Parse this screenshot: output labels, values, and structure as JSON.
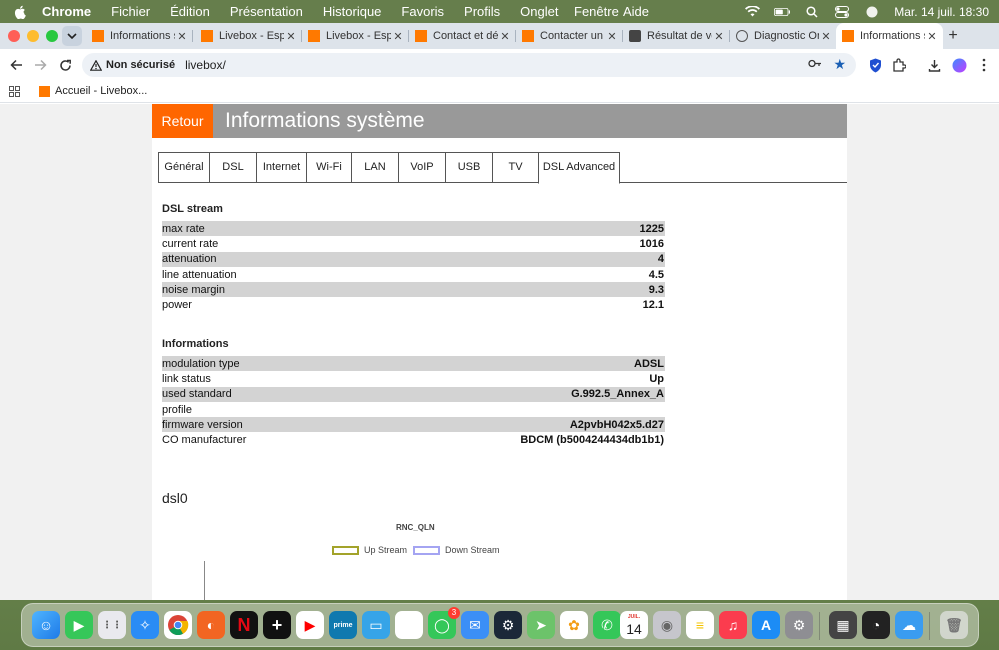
{
  "menubar": {
    "app": "Chrome",
    "items": [
      "Fichier",
      "Édition",
      "Présentation",
      "Historique",
      "Favoris",
      "Profils",
      "Onglet"
    ],
    "window": "Fenêtre",
    "help": "Aide",
    "datetime": "Mar. 14 juil.  18:30"
  },
  "browser": {
    "tabs": [
      {
        "label": "Informations sys",
        "icon": "orange-square-icon"
      },
      {
        "label": "Livebox - Espace",
        "icon": "orange-square-icon"
      },
      {
        "label": "Livebox - Espace",
        "icon": "orange-square-icon"
      },
      {
        "label": "Contact et déma",
        "icon": "orange-square-icon"
      },
      {
        "label": "Contacter un co",
        "icon": "orange-square-icon"
      },
      {
        "label": "Résultat de vot",
        "icon": "speedtest-icon"
      },
      {
        "label": "Diagnostic Ora",
        "icon": "globe-icon"
      },
      {
        "label": "Informations sys",
        "icon": "orange-square-icon"
      }
    ],
    "active_tab_index": 7,
    "address": {
      "security": "Non sécurisé",
      "url": "livebox/"
    },
    "bookmarks": [
      {
        "label": "Accueil - Livebox..."
      }
    ]
  },
  "page": {
    "back_label": "Retour",
    "title": "Informations système",
    "tabs": [
      "Général",
      "DSL",
      "Internet",
      "Wi-Fi",
      "LAN",
      "VoIP",
      "USB",
      "TV",
      "DSL Advanced"
    ],
    "active_tab": "DSL Advanced",
    "dsl_stream": {
      "title": "DSL stream",
      "rows": [
        {
          "label": "max rate",
          "value": "1225"
        },
        {
          "label": "current rate",
          "value": "1016"
        },
        {
          "label": "attenuation",
          "value": "4"
        },
        {
          "label": "line attenuation",
          "value": "4.5"
        },
        {
          "label": "noise margin",
          "value": "9.3"
        },
        {
          "label": "power",
          "value": "12.1"
        }
      ]
    },
    "informations": {
      "title": "Informations",
      "rows": [
        {
          "label": "modulation type",
          "value": "ADSL"
        },
        {
          "label": "link status",
          "value": "Up"
        },
        {
          "label": "used standard",
          "value": "G.992.5_Annex_A"
        },
        {
          "label": "profile",
          "value": ""
        },
        {
          "label": "firmware version",
          "value": "A2pvbH042x5.d27"
        },
        {
          "label": "CO manufacturer",
          "value": "BDCM (b5004244434db1b1)"
        }
      ]
    },
    "dsl0": {
      "heading": "dsl0",
      "chart_title": "RNC_QLN",
      "legend": [
        {
          "label": "Up Stream",
          "color": "#a3a32a"
        },
        {
          "label": "Down Stream",
          "color": "#a4a4f2"
        }
      ]
    }
  },
  "dock": {
    "messages_badge": "3",
    "calendar_month": "JUIL.",
    "calendar_day": "14"
  },
  "colors": {
    "orange_accent": "#ff6600",
    "header_gray": "#999999",
    "row_shade": "#d3d3d3"
  }
}
